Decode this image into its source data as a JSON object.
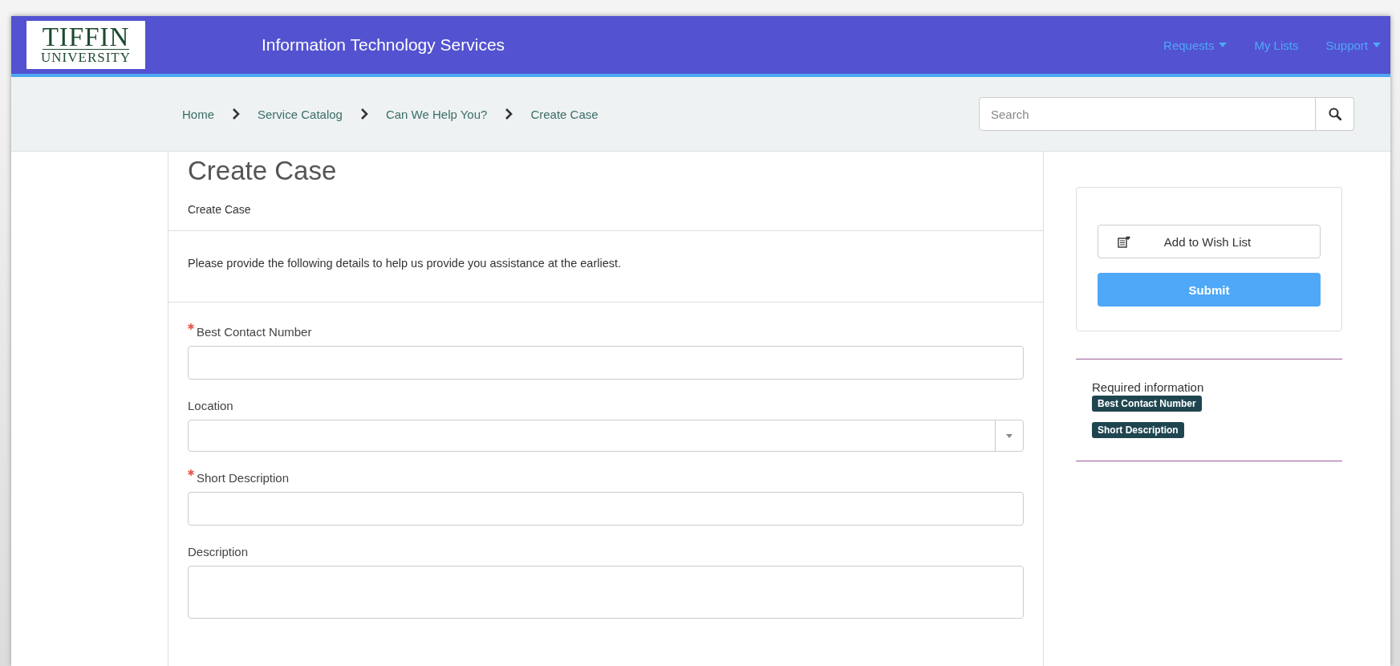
{
  "header": {
    "logo": {
      "line_1": "TIFFIN",
      "line_2": "UNIVERSITY"
    },
    "title": "Information Technology Services",
    "nav": [
      {
        "label": "Requests",
        "dropdown": true
      },
      {
        "label": "My Lists",
        "dropdown": false
      },
      {
        "label": "Support",
        "dropdown": true
      }
    ]
  },
  "breadcrumbs": [
    "Home",
    "Service Catalog",
    "Can We Help You?",
    "Create Case"
  ],
  "search": {
    "placeholder": "Search"
  },
  "form": {
    "title": "Create Case",
    "subtitle": "Create Case",
    "intro": "Please provide the following details to help us provide you assistance at the earliest.",
    "fields": [
      {
        "label": "Best Contact Number",
        "required": true,
        "kind": "text"
      },
      {
        "label": "Location",
        "required": false,
        "kind": "select"
      },
      {
        "label": "Short Description",
        "required": true,
        "kind": "text"
      },
      {
        "label": "Description",
        "required": false,
        "kind": "textarea"
      }
    ]
  },
  "sidebar": {
    "wish_button": "Add to Wish List",
    "submit_button": "Submit",
    "required_title": "Required information",
    "required_tags": [
      "Best Contact Number",
      "Short Description"
    ]
  }
}
